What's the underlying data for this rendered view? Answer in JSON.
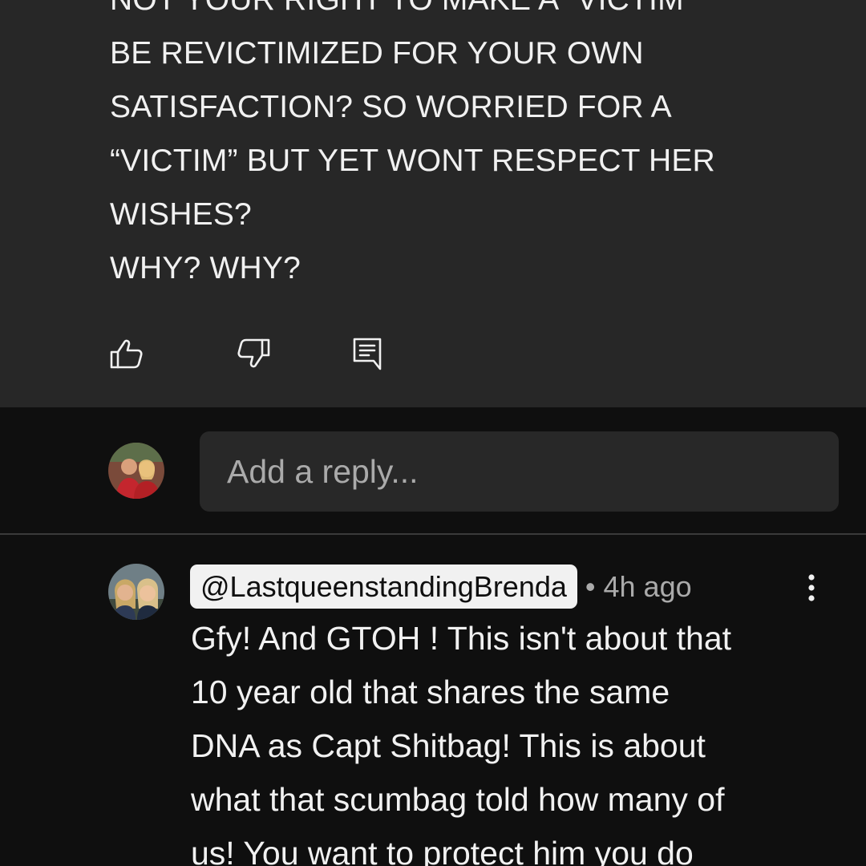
{
  "parent_comment": {
    "lines": [
      "NOT YOUR RIGHT TO MAKE A “VICTIM”",
      "BE REVICTIMIZED  FOR YOUR OWN",
      "SATISFACTION?  SO WORRIED FOR A",
      "“VICTIM” BUT YET WONT RESPECT HER",
      "WISHES?",
      "WHY? WHY?"
    ],
    "actions": {
      "like_icon": "thumbs-up-icon",
      "dislike_icon": "thumbs-down-icon",
      "reply_icon": "comment-reply-icon"
    }
  },
  "reply_box": {
    "placeholder": "Add a reply...",
    "avatar_icon": "user-avatar"
  },
  "reply_comment": {
    "handle": "@LastqueenstandingBrenda",
    "meta": "• 4h ago",
    "menu_icon": "more-vertical-icon",
    "lines": [
      "Gfy! And GTOH ! This isn't about that",
      "10 year old that shares the same",
      "DNA as Capt Shitbag! This is about",
      "what that scumbag told how many of",
      "us! You want to protect him you do"
    ]
  },
  "colors": {
    "background": "#0f0f0f",
    "highlight_background": "#272727",
    "input_background": "#282828",
    "text": "#f1f1f1",
    "secondary_text": "#aaaaaa"
  }
}
